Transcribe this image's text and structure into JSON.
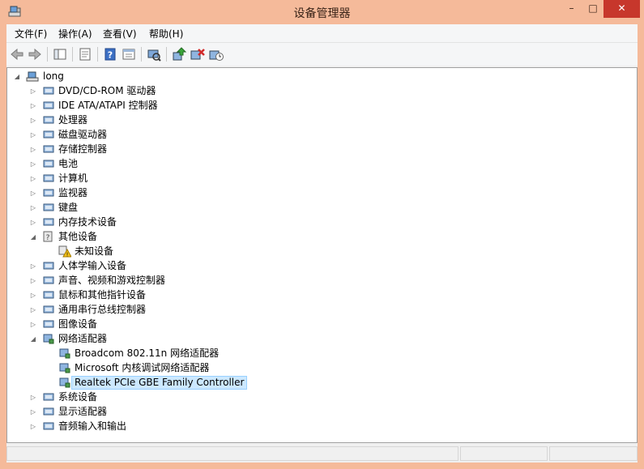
{
  "window": {
    "title": "设备管理器",
    "min_glyph": "–",
    "max_glyph": "□",
    "close_glyph": "✕"
  },
  "menu": [
    "文件(F)",
    "操作(A)",
    "查看(V)",
    "帮助(H)"
  ],
  "toolbar": [
    "back-icon",
    "forward-icon",
    "show-hide-tree-icon",
    "properties-icon",
    "help-icon",
    "view-icon",
    "scan-hardware-icon",
    "update-driver-icon",
    "uninstall-icon",
    "enable-device-icon"
  ],
  "tree": {
    "root": "long",
    "items": [
      {
        "label": "DVD/CD-ROM 驱动器",
        "expanded": false
      },
      {
        "label": "IDE ATA/ATAPI 控制器",
        "expanded": false
      },
      {
        "label": "处理器",
        "expanded": false
      },
      {
        "label": "磁盘驱动器",
        "expanded": false
      },
      {
        "label": "存储控制器",
        "expanded": false
      },
      {
        "label": "电池",
        "expanded": false
      },
      {
        "label": "计算机",
        "expanded": false
      },
      {
        "label": "监视器",
        "expanded": false
      },
      {
        "label": "键盘",
        "expanded": false
      },
      {
        "label": "内存技术设备",
        "expanded": false
      },
      {
        "label": "其他设备",
        "expanded": true,
        "children": [
          "未知设备"
        ]
      },
      {
        "label": "人体学输入设备",
        "expanded": false
      },
      {
        "label": "声音、视频和游戏控制器",
        "expanded": false
      },
      {
        "label": "鼠标和其他指针设备",
        "expanded": false
      },
      {
        "label": "通用串行总线控制器",
        "expanded": false
      },
      {
        "label": "图像设备",
        "expanded": false
      },
      {
        "label": "网络适配器",
        "expanded": true,
        "children": [
          "Broadcom 802.11n 网络适配器",
          "Microsoft 内核调试网络适配器",
          "Realtek PCIe GBE Family Controller"
        ],
        "selected_child": 2
      },
      {
        "label": "系统设备",
        "expanded": false
      },
      {
        "label": "显示适配器",
        "expanded": false
      },
      {
        "label": "音频输入和输出",
        "expanded": false
      }
    ]
  }
}
